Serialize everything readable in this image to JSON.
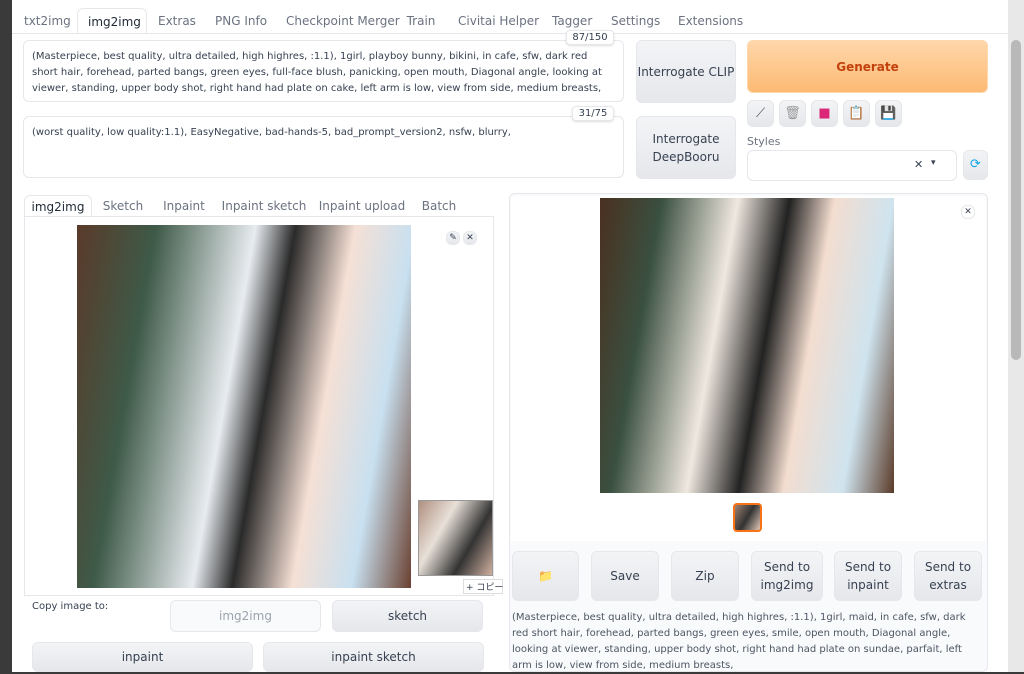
{
  "tabs": [
    "txt2img",
    "img2img",
    "Extras",
    "PNG Info",
    "Checkpoint Merger",
    "Train",
    "Civitai Helper",
    "Tagger",
    "Settings",
    "Extensions"
  ],
  "active_tab": "img2img",
  "prompt": {
    "value": "(Masterpiece, best quality, ultra detailed, high highres, :1.1), 1girl, playboy bunny, bikini, in cafe, sfw, dark red short hair, forehead, parted bangs, green eyes, full-face blush, panicking, open mouth, Diagonal angle, looking at viewer, standing, upper body shot, right hand had plate on cake, left arm is low, view from side, medium breasts,",
    "counter": "87/150"
  },
  "negative_prompt": {
    "value": "(worst quality, low quality:1.1), EasyNegative,  bad-hands-5,  bad_prompt_version2, nsfw, blurry,",
    "counter": "31/75"
  },
  "buttons": {
    "interrogate_clip": "Interrogate CLIP",
    "interrogate_deepbooru": "Interrogate DeepBooru",
    "generate": "Generate"
  },
  "tools": [
    "pencil-icon",
    "trash-icon",
    "card-icon",
    "clipboard-icon",
    "save-icon"
  ],
  "styles": {
    "label": "Styles",
    "value": ""
  },
  "sub_tabs": [
    "img2img",
    "Sketch",
    "Inpaint",
    "Inpaint sketch",
    "Inpaint upload",
    "Batch"
  ],
  "copy": {
    "label": "Copy image to:",
    "img2img": "img2img",
    "sketch": "sketch",
    "inpaint": "inpaint",
    "inpaint_sketch": "inpaint sketch",
    "copy_badge": "+ コピー"
  },
  "output_buttons": {
    "folder": "📁",
    "save": "Save",
    "zip": "Zip",
    "send_img2img": "Send to img2img",
    "send_inpaint": "Send to inpaint",
    "send_extras": "Send to extras"
  },
  "output_info": "(Masterpiece, best quality, ultra detailed, high highres, :1.1), 1girl, maid, in cafe, sfw, dark red short hair, forehead, parted bangs, green eyes, smile, open mouth, Diagonal angle, looking at viewer, standing, upper body shot, right hand had plate on sundae, parfait, left arm is low, view from side, medium breasts,",
  "colors": {
    "accent": "#f97316",
    "generate_bg": "#fdba74"
  }
}
